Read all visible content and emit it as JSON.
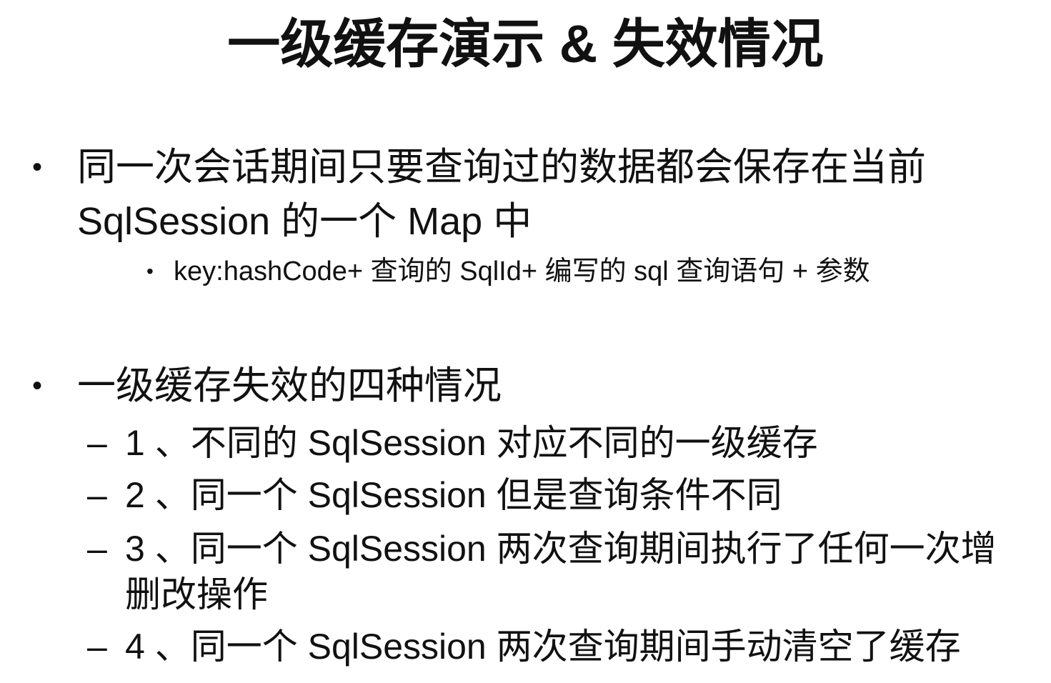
{
  "title": "一级缓存演示 & 失效情况",
  "bullets": [
    {
      "bullet": "•",
      "text": "同一次会话期间只要查询过的数据都会保存在当前 SqlSession 的一个 Map 中",
      "sub": [
        {
          "bullet": "•",
          "text": "key:hashCode+ 查询的 SqlId+ 编写的 sql 查询语句 + 参数"
        }
      ]
    },
    {
      "bullet": "•",
      "text": "一级缓存失效的四种情况",
      "items": [
        {
          "dash": "–",
          "text": "1 、不同的 SqlSession 对应不同的一级缓存"
        },
        {
          "dash": "–",
          "text": "2 、同一个 SqlSession 但是查询条件不同"
        },
        {
          "dash": "–",
          "text": "3 、同一个 SqlSession 两次查询期间执行了任何一次增删改操作"
        },
        {
          "dash": "–",
          "text": "4 、同一个 SqlSession 两次查询期间手动清空了缓存"
        }
      ]
    }
  ]
}
